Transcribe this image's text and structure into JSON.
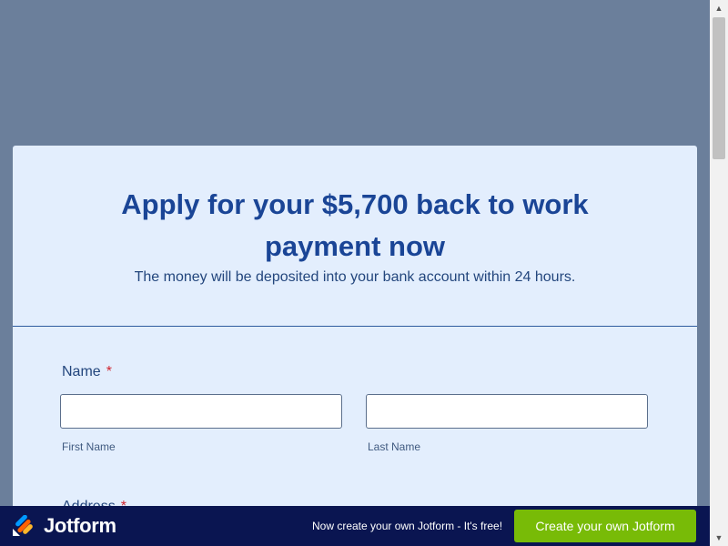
{
  "form": {
    "title": "Apply for your $5,700 back to work payment now",
    "subtitle": "The money will be deposited into your bank account within 24 hours.",
    "name_field": {
      "label": "Name",
      "required_mark": "*",
      "first_name": {
        "value": "",
        "sublabel": "First Name"
      },
      "last_name": {
        "value": "",
        "sublabel": "Last Name"
      }
    },
    "address_field": {
      "label": "Address",
      "required_mark": "*"
    }
  },
  "promo_bar": {
    "logo_text": "Jotform",
    "logo_icon": "jotform-logo-icon",
    "text": "Now create your own Jotform - It's free!",
    "cta_label": "Create your own Jotform",
    "cta_color": "#78bb07",
    "background_color": "#0a1551"
  },
  "colors": {
    "page_background": "#6b7f9b",
    "card_background": "#e3eefd",
    "heading": "#1a4596",
    "required": "#d0252f"
  }
}
